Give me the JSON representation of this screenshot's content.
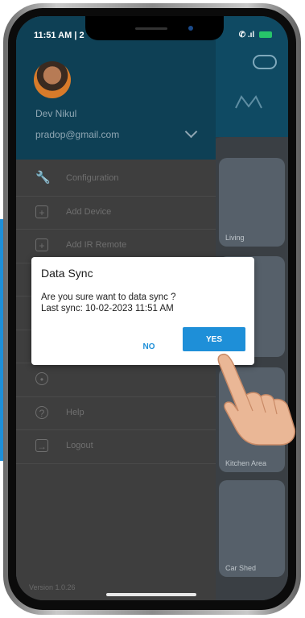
{
  "status_bar": {
    "time": "11:51 AM | 2",
    "signal": "✆ .ıl"
  },
  "drawer": {
    "user_name": "Dev Nikul",
    "user_email": "pradop@gmail.com",
    "menu": [
      {
        "label": "Configuration",
        "icon": "wrench-icon"
      },
      {
        "label": "Add Device",
        "icon": "plus-square-icon"
      },
      {
        "label": "Add IR Remote",
        "icon": "plus-square-icon"
      },
      {
        "label": "",
        "icon": "gear-icon"
      },
      {
        "label": "",
        "icon": "cloud-icon"
      },
      {
        "label": "",
        "icon": "info-icon"
      },
      {
        "label": "",
        "icon": "user-icon"
      },
      {
        "label": "Help",
        "icon": "help-icon"
      },
      {
        "label": "Logout",
        "icon": "logout-icon"
      }
    ],
    "version": "Version 1.0.26"
  },
  "background_cards": {
    "card_top": "Living",
    "card_mid": "Kitchen Area",
    "card_bottom": "Car Shed"
  },
  "dialog": {
    "title": "Data Sync",
    "message_line1": "Are you sure want to data sync ?",
    "message_line2": "Last sync: 10-02-2023 11:51 AM",
    "no_label": "NO",
    "yes_label": "YES"
  },
  "colors": {
    "accent": "#1e8fd8",
    "drawer_header": "#0e4055",
    "drawer_bg": "#3e3e3e"
  }
}
